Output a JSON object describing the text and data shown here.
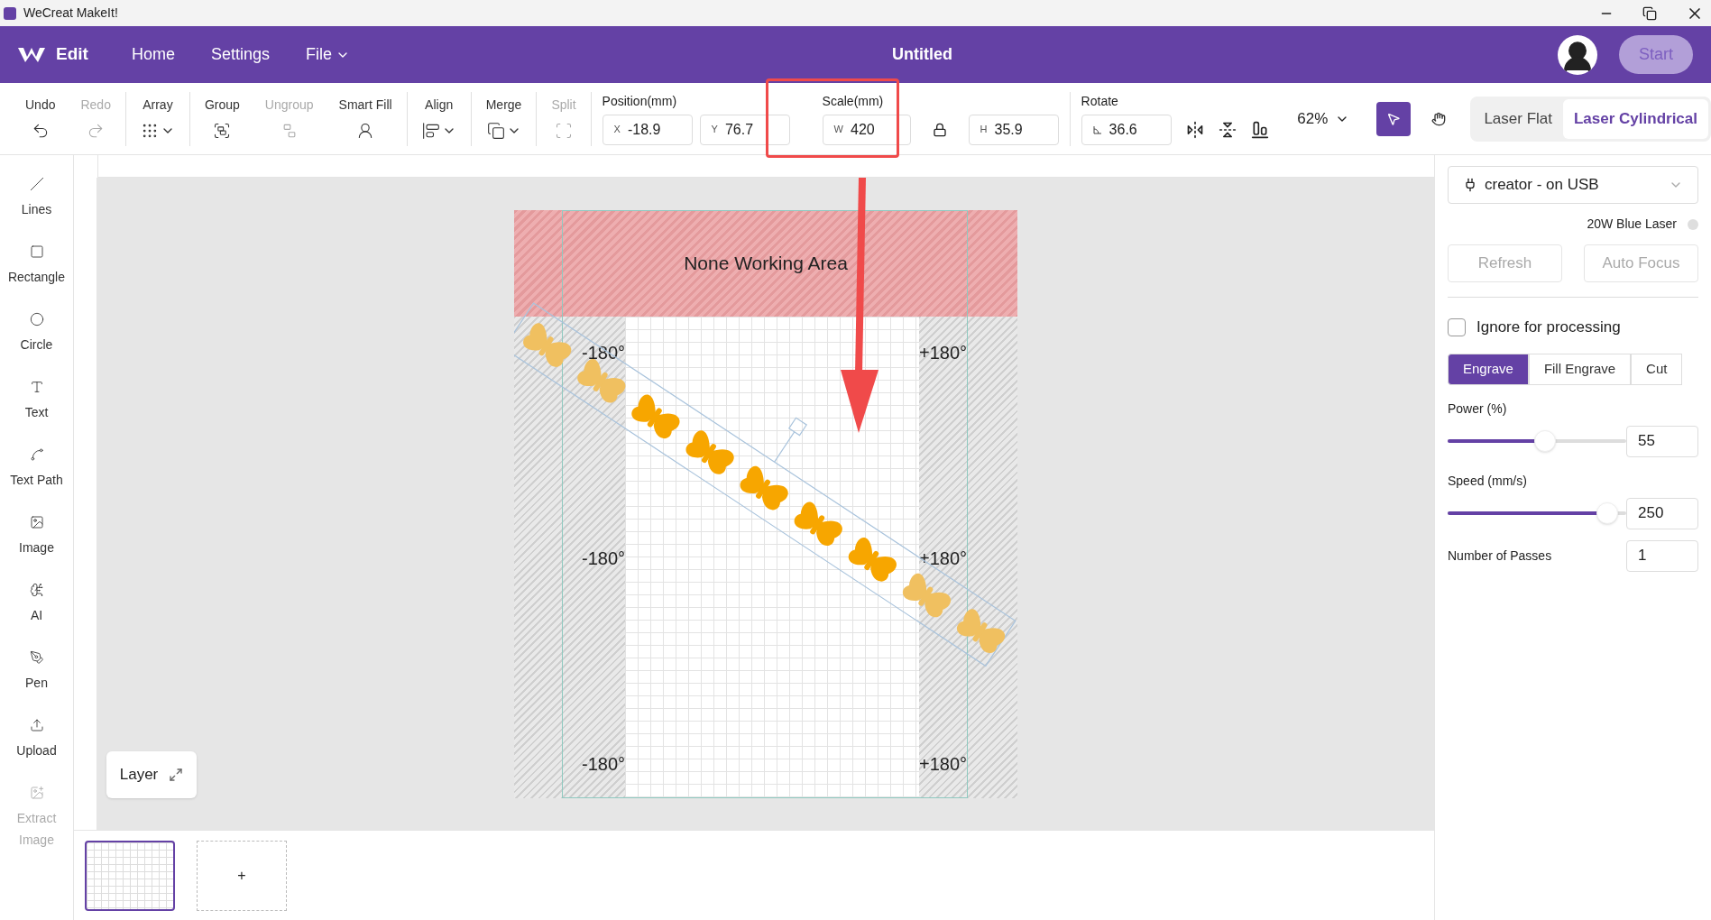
{
  "window": {
    "title": "WeCreat MakeIt!"
  },
  "header": {
    "mode": "Edit",
    "nav": [
      {
        "label": "Home",
        "kind": "link"
      },
      {
        "label": "Settings",
        "kind": "link"
      },
      {
        "label": "File",
        "kind": "dropdown"
      }
    ],
    "document_title": "Untitled",
    "start_button": {
      "label": "Start",
      "disabled": true
    }
  },
  "toolbar": {
    "groups": [
      [
        {
          "label": "Undo",
          "kind": "button",
          "disabled": false
        },
        {
          "label": "Redo",
          "kind": "button",
          "disabled": true
        }
      ],
      [
        {
          "label": "Array",
          "kind": "dropdown",
          "disabled": false
        }
      ],
      [
        {
          "label": "Group",
          "kind": "button",
          "disabled": false
        },
        {
          "label": "Ungroup",
          "kind": "button",
          "disabled": true
        },
        {
          "label": "Smart Fill",
          "kind": "button",
          "disabled": false
        }
      ],
      [
        {
          "label": "Align",
          "kind": "dropdown",
          "disabled": false
        }
      ],
      [
        {
          "label": "Merge",
          "kind": "dropdown",
          "disabled": false
        }
      ],
      [
        {
          "label": "Split",
          "kind": "button",
          "disabled": true
        }
      ]
    ],
    "position": {
      "label": "Position(mm)",
      "fields": [
        {
          "prefix": "X",
          "value": "-18.9"
        },
        {
          "prefix": "Y",
          "value": "76.7"
        }
      ]
    },
    "scale": {
      "label": "Scale(mm)",
      "width": {
        "prefix": "W",
        "value": "420"
      },
      "height": {
        "prefix": "H",
        "value": "35.9"
      }
    },
    "rotate": {
      "label": "Rotate",
      "value": "36.6"
    },
    "zoom": "62%",
    "tools": [
      {
        "selected": true
      },
      {
        "selected": false
      }
    ],
    "modes": [
      {
        "label": "Laser Flat",
        "selected": false
      },
      {
        "label": "Laser Cylindrical",
        "selected": true
      }
    ]
  },
  "sidebar": {
    "items": [
      {
        "label": "Lines",
        "disabled": false
      },
      {
        "label": "Rectangle",
        "disabled": false
      },
      {
        "label": "Circle",
        "disabled": false
      },
      {
        "label": "Text",
        "disabled": false
      },
      {
        "label": "Text Path",
        "disabled": false
      },
      {
        "label": "Image",
        "disabled": false
      },
      {
        "label": "AI",
        "disabled": false
      },
      {
        "label": "Pen",
        "disabled": false
      },
      {
        "label": "Upload",
        "disabled": false
      },
      {
        "label": "Extract Image",
        "disabled": true
      }
    ]
  },
  "canvas": {
    "restricted_label": "None Working Area",
    "angle_rows": [
      {
        "left": "-180°",
        "right": "+180°"
      },
      {
        "left": "-180°",
        "right": "+180°"
      },
      {
        "left": "-180°",
        "right": "+180°"
      }
    ],
    "layer_button": "Layer"
  },
  "pages": {
    "items": [
      {
        "selected": true
      }
    ],
    "add_button": "+"
  },
  "device_panel": {
    "device": "creator - on USB",
    "laser": "20W Blue Laser",
    "laser_connected": false,
    "buttons": [
      {
        "label": "Refresh",
        "disabled": true
      },
      {
        "label": "Auto Focus",
        "disabled": true
      }
    ]
  },
  "process_panel": {
    "ignore": {
      "label": "Ignore for processing",
      "checked": false
    },
    "modes": [
      {
        "label": "Engrave",
        "selected": true
      },
      {
        "label": "Fill Engrave",
        "selected": false
      },
      {
        "label": "Cut",
        "selected": false
      }
    ],
    "sliders": [
      {
        "label": "Power (%)",
        "level": 0.55,
        "value": "55"
      },
      {
        "label": "Speed (mm/s)",
        "level": 0.95,
        "value": "250"
      }
    ],
    "passes": {
      "label": "Number of Passes",
      "value": "1"
    }
  }
}
